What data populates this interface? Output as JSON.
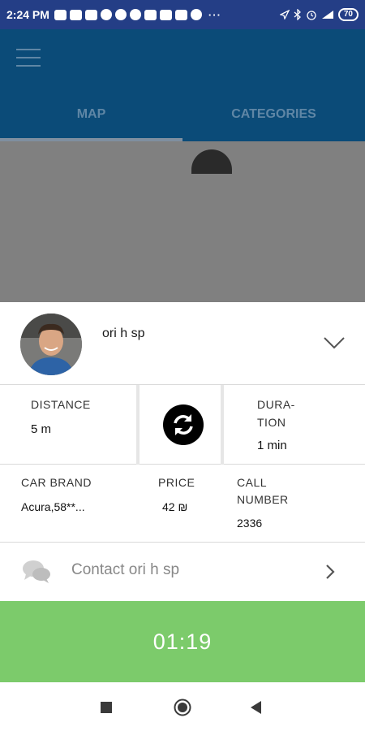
{
  "status_bar": {
    "time": "2:24 PM",
    "overflow": "···",
    "battery": "70"
  },
  "app_bar": {
    "tabs": [
      {
        "label": "MAP"
      },
      {
        "label": "CATEGORIES"
      }
    ]
  },
  "driver": {
    "name": "ori h sp"
  },
  "stats": {
    "distance_label": "DISTANCE",
    "distance_value": "5 m",
    "duration_label_1": "DURA-",
    "duration_label_2": "TION",
    "duration_value": "1 min"
  },
  "info": {
    "car_brand_label": "CAR BRAND",
    "car_brand_value": "Acura,58**...",
    "price_label": "PRICE",
    "price_value": "42 ₪",
    "call_label_1": "CALL",
    "call_label_2": "NUMBER",
    "call_value": "2336"
  },
  "contact": {
    "label": "Contact ori h sp"
  },
  "timer": {
    "value": "01:19"
  },
  "colors": {
    "status_bar": "#243e86",
    "app_bar": "#0b4b78",
    "timer": "#7ccb6b"
  },
  "icons": [
    "menu-icon",
    "chevron-down-icon",
    "refresh-icon",
    "chat-icon",
    "chevron-right-icon",
    "nav-recents-icon",
    "nav-home-icon",
    "nav-back-icon"
  ]
}
